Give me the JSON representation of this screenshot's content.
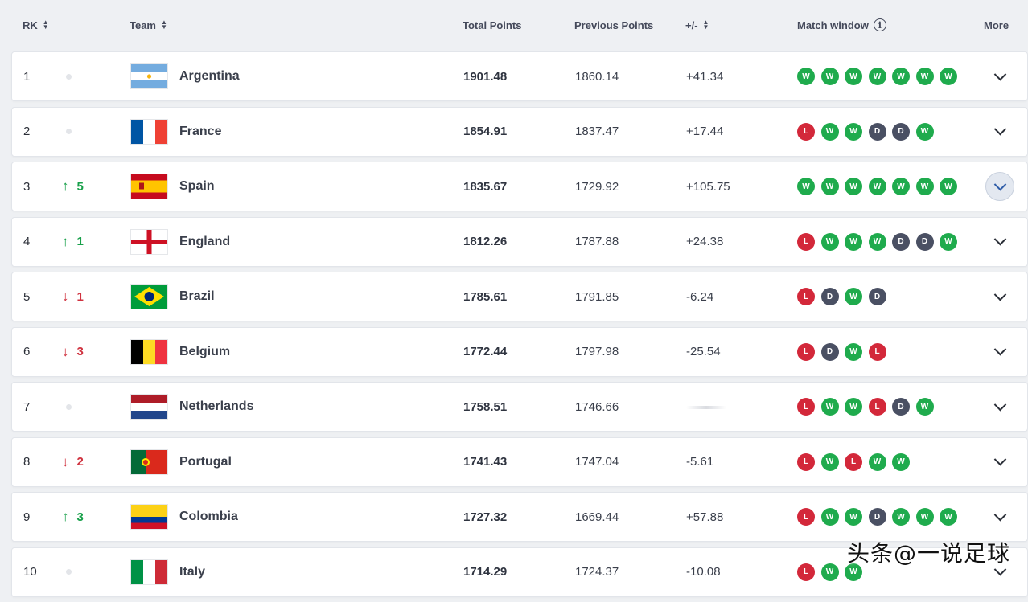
{
  "header": {
    "rk": "RK",
    "team": "Team",
    "total_points": "Total Points",
    "previous_points": "Previous Points",
    "diff": "+/-",
    "match_window": "Match window",
    "more": "More"
  },
  "colors": {
    "win": "#1fab4d",
    "loss": "#d3283a",
    "draw": "#4a5063",
    "up": "#18a04a",
    "down": "#d0323f"
  },
  "rows": [
    {
      "rank": "1",
      "move": "none",
      "move_value": "",
      "team": "Argentina",
      "flag": "argentina",
      "total": "1901.48",
      "previous": "1860.14",
      "diff": "+41.34",
      "window": [
        "W",
        "W",
        "W",
        "W",
        "W",
        "W",
        "W"
      ]
    },
    {
      "rank": "2",
      "move": "none",
      "move_value": "",
      "team": "France",
      "flag": "france",
      "total": "1854.91",
      "previous": "1837.47",
      "diff": "+17.44",
      "window": [
        "L",
        "W",
        "W",
        "D",
        "D",
        "W"
      ]
    },
    {
      "rank": "3",
      "move": "up",
      "move_value": "5",
      "team": "Spain",
      "flag": "spain",
      "total": "1835.67",
      "previous": "1729.92",
      "diff": "+105.75",
      "window": [
        "W",
        "W",
        "W",
        "W",
        "W",
        "W",
        "W"
      ]
    },
    {
      "rank": "4",
      "move": "up",
      "move_value": "1",
      "team": "England",
      "flag": "england",
      "total": "1812.26",
      "previous": "1787.88",
      "diff": "+24.38",
      "window": [
        "L",
        "W",
        "W",
        "W",
        "D",
        "D",
        "W"
      ]
    },
    {
      "rank": "5",
      "move": "down",
      "move_value": "1",
      "team": "Brazil",
      "flag": "brazil",
      "total": "1785.61",
      "previous": "1791.85",
      "diff": "-6.24",
      "window": [
        "L",
        "D",
        "W",
        "D"
      ]
    },
    {
      "rank": "6",
      "move": "down",
      "move_value": "3",
      "team": "Belgium",
      "flag": "belgium",
      "total": "1772.44",
      "previous": "1797.98",
      "diff": "-25.54",
      "window": [
        "L",
        "D",
        "W",
        "L"
      ]
    },
    {
      "rank": "7",
      "move": "none",
      "move_value": "",
      "team": "Netherlands",
      "flag": "netherlands",
      "total": "1758.51",
      "previous": "1746.66",
      "diff": "",
      "window": [
        "L",
        "W",
        "W",
        "L",
        "D",
        "W"
      ]
    },
    {
      "rank": "8",
      "move": "down",
      "move_value": "2",
      "team": "Portugal",
      "flag": "portugal",
      "total": "1741.43",
      "previous": "1747.04",
      "diff": "-5.61",
      "window": [
        "L",
        "W",
        "L",
        "W",
        "W"
      ]
    },
    {
      "rank": "9",
      "move": "up",
      "move_value": "3",
      "team": "Colombia",
      "flag": "colombia",
      "total": "1727.32",
      "previous": "1669.44",
      "diff": "+57.88",
      "window": [
        "L",
        "W",
        "W",
        "D",
        "W",
        "W",
        "W"
      ]
    },
    {
      "rank": "10",
      "move": "none",
      "move_value": "",
      "team": "Italy",
      "flag": "italy",
      "total": "1714.29",
      "previous": "1724.37",
      "diff": "-10.08",
      "window": [
        "L",
        "W",
        "W"
      ]
    }
  ],
  "watermark": "头条@一说足球"
}
